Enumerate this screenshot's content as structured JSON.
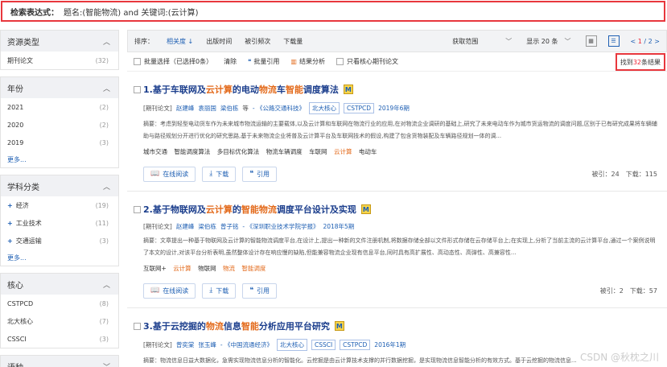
{
  "search": {
    "label": "检索表达式：",
    "expression": "题名:(智能物流) and 关键词:(云计算)"
  },
  "sidebar": {
    "groups": [
      {
        "title": "资源类型",
        "items": [
          {
            "label": "期刊论文",
            "count": "(32)"
          }
        ]
      },
      {
        "title": "年份",
        "items": [
          {
            "label": "2021",
            "count": "(2)"
          },
          {
            "label": "2020",
            "count": "(2)"
          },
          {
            "label": "2019",
            "count": "(3)"
          }
        ],
        "more": "更多..."
      },
      {
        "title": "学科分类",
        "items": [
          {
            "label": "经济",
            "count": "(19)"
          },
          {
            "label": "工业技术",
            "count": "(11)"
          },
          {
            "label": "交通运输",
            "count": "(3)"
          }
        ],
        "more": "更多..."
      },
      {
        "title": "核心",
        "items": [
          {
            "label": "CSTPCD",
            "count": "(8)"
          },
          {
            "label": "北大核心",
            "count": "(7)"
          },
          {
            "label": "CSSCI",
            "count": "(3)"
          }
        ]
      },
      {
        "title": "语种"
      }
    ]
  },
  "toolbar": {
    "sort_label": "排序：",
    "sort_options": [
      "相关度",
      "出版时间",
      "被引频次",
      "下载量"
    ],
    "scope": "获取范围",
    "page_size": "显示 20 条",
    "pager_prefix": "< ",
    "pager_current": "1",
    "pager_suffix": " / 2 >"
  },
  "actions": {
    "select_all": "批量选择（已选择0条）",
    "clear": "清除",
    "batch_cite": "批量引用",
    "analysis": "结果分析",
    "core_only": "只看核心期刊论文",
    "found_prefix": "找到",
    "found_count": "32",
    "found_suffix": "条结果"
  },
  "results": [
    {
      "title_parts": [
        "1.基于车联网及",
        "云计算",
        "的电动",
        "物流",
        "车",
        "智能",
        "调度算法"
      ],
      "type": "[期刊论文]",
      "authors": [
        "赵建峰",
        "袁丽国",
        "梁伯栋",
        "等"
      ],
      "source": "- 《公路交通科技》",
      "tags": [
        "北大核心",
        "CSTPCD"
      ],
      "date": "2019年6期",
      "abstract": "摘要：考虑到轻型电动货车作为未来城市物流运输的主要载体,以及云计算和车联网在物流行业的应用,在对物流企业调研的基础上,研究了未来电动车作为城市货运物流的调度问题,区别于已有研究成果将车辆辅助与路径规划分开进行优化的研究思路,基于未来物流企业将普及云计算平台及车联网技术的假设,构建了包含货物装配及车辆路径规划一体的调...",
      "keywords": [
        "城市交通",
        "智能调度算法",
        "多目标优化算法",
        "物流车辆调度",
        "车联网",
        "云计算",
        "电动车"
      ],
      "read": "在线阅读",
      "download": "下载",
      "cite": "引用",
      "cited": "被引：24",
      "downloads": "下载：115"
    },
    {
      "title_parts": [
        "2.基于物联网及",
        "云计算",
        "的",
        "智能物流",
        "调度平台设计及实现"
      ],
      "type": "[期刊论文]",
      "authors": [
        "赵建峰",
        "梁伯栋",
        "曾子铭"
      ],
      "source": "- 《深圳职业技术学院学报》",
      "tags": [],
      "date": "2018年5期",
      "abstract": "摘要：文章提出一种基于物联网及云计算的智能物流调度平台,在设计上,提出一种新的文件注册机制,将数据存储全部以文件形式存储在云存储平台上;在实现上,分析了当前主流的云计算平台,通过一个案例说明了本文的设计,对该平台分析表明,虽然整体设计存在响应慢的缺陷,但能兼容物流企业现有信息平台,同时具有高扩展性、高动态性、高弹性、高兼容性...",
      "keywords": [
        "互联网+",
        "云计算",
        "物联网",
        "物流",
        "智能调度"
      ],
      "read": "在线阅读",
      "download": "下载",
      "cite": "引用",
      "cited": "被引：2",
      "downloads": "下载：57"
    },
    {
      "title_parts": [
        "3.基于云挖掘的",
        "物流",
        "信息",
        "智能",
        "分析应用平台研究"
      ],
      "type": "[期刊论文]",
      "authors": [
        "曾奕棠",
        "张玉峰"
      ],
      "source": "- 《中国流通经济》",
      "tags": [
        "北大核心",
        "CSSCI",
        "CSTPCD"
      ],
      "date": "2016年1期",
      "abstract": "摘要：物流信息日益大数据化，急需实现物流信息分析的智能化。云挖掘是由云计算技术支撑的并行数据挖掘，是实现物流信息智能分析的有效方式。基于云挖掘的物流信息..."
    }
  ],
  "watermark": "CSDN @秋枕之川"
}
